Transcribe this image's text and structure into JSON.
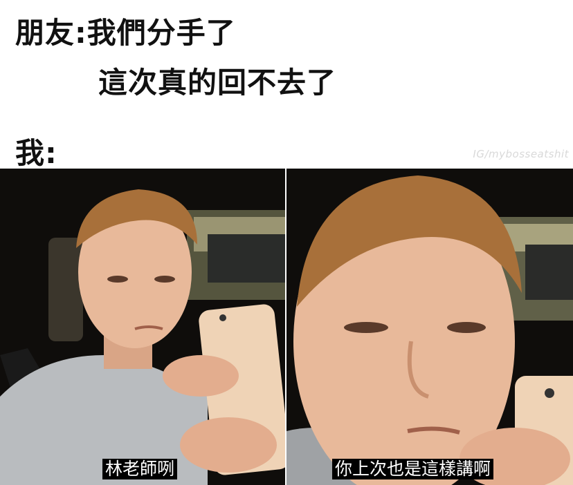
{
  "meme": {
    "caption_line1": "朋友:我們分手了",
    "caption_line2": "這次真的回不去了",
    "caption_line3": "我:",
    "watermark": "IG/mybosseatshit",
    "subtitle_left": "林老師咧",
    "subtitle_right": "你上次也是這樣講啊"
  },
  "colors": {
    "caption_text": "#111111",
    "watermark": "#d9d9d9",
    "subtitle_bg": "#000000",
    "subtitle_text": "#ffffff",
    "skin": "#e8b99a",
    "hair": "#a8703a",
    "hoodie": "#b9bcbf",
    "phone": "#efd3b6",
    "car_dark": "#0f0d0b"
  },
  "panels": [
    {
      "label": "left-frame",
      "subject": "man in car looking at phone"
    },
    {
      "label": "right-frame",
      "subject": "close-up of man's face looking at phone"
    }
  ]
}
